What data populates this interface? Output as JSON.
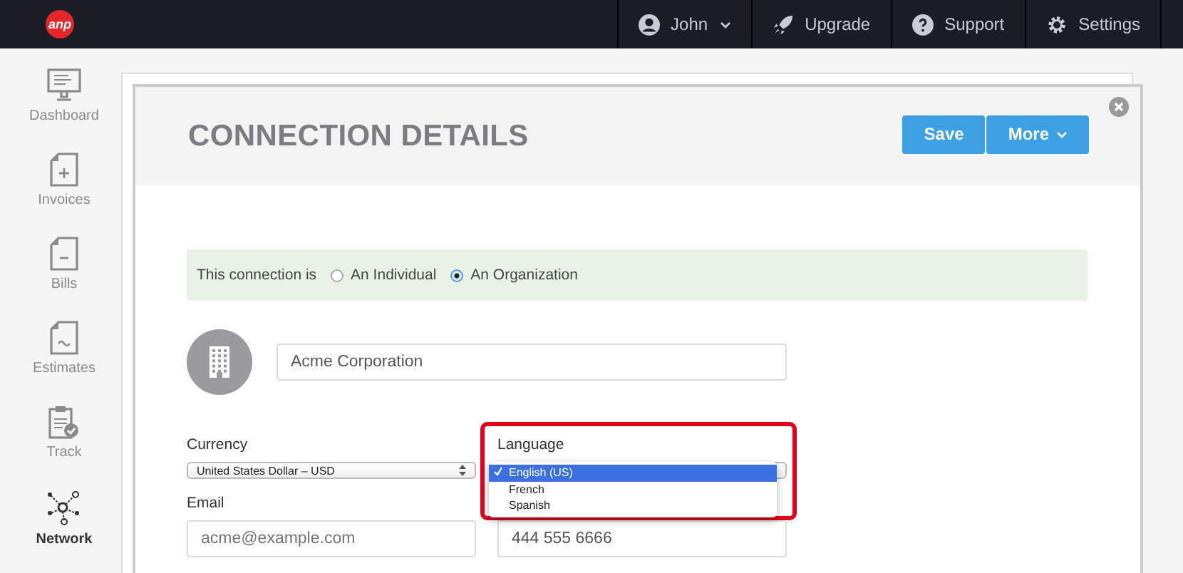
{
  "logo": {
    "text": "anp"
  },
  "nav": [
    {
      "label": "John",
      "kind": "user"
    },
    {
      "label": "Upgrade",
      "kind": "upgrade"
    },
    {
      "label": "Support",
      "kind": "support"
    },
    {
      "label": "Settings",
      "kind": "settings"
    }
  ],
  "sidebar": {
    "items": [
      {
        "label": "Dashboard",
        "kind": "dashboard",
        "selected": false
      },
      {
        "label": "Invoices",
        "kind": "invoices",
        "selected": false
      },
      {
        "label": "Bills",
        "kind": "bills",
        "selected": false
      },
      {
        "label": "Estimates",
        "kind": "estimates",
        "selected": false
      },
      {
        "label": "Track",
        "kind": "track",
        "selected": false
      },
      {
        "label": "Network",
        "kind": "network",
        "selected": true
      }
    ]
  },
  "modal": {
    "title": "CONNECTION DETAILS",
    "buttons": [
      {
        "label": "Save",
        "kind": "save"
      },
      {
        "label": "More",
        "kind": "more"
      }
    ],
    "type_bar": {
      "label": "This connection is",
      "options": [
        {
          "label": "An Individual",
          "selected": false
        },
        {
          "label": "An Organization",
          "selected": true
        }
      ]
    },
    "name_field": {
      "value": "Acme Corporation"
    },
    "currency": {
      "label": "Currency",
      "value": "United States Dollar – USD"
    },
    "language": {
      "label": "Language",
      "options": [
        {
          "label": "English (US)",
          "selected": true
        },
        {
          "label": "French",
          "selected": false
        },
        {
          "label": "Spanish",
          "selected": false
        }
      ]
    },
    "email": {
      "label": "Email",
      "placeholder": "acme@example.com"
    },
    "phone": {
      "value": "444 555 6666"
    }
  }
}
